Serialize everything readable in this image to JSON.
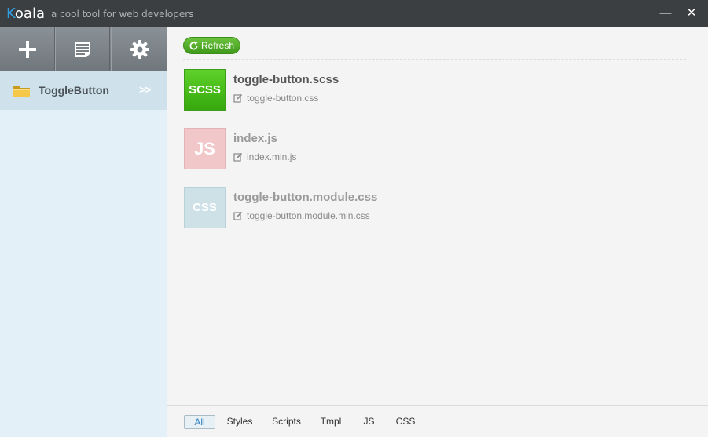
{
  "window": {
    "app_name_first": "K",
    "app_name_rest": "oala",
    "tagline": "a cool tool for web developers",
    "minimize_glyph": "—",
    "close_glyph": "✕"
  },
  "sidebar": {
    "toolbar": [
      {
        "icon": "plus-icon"
      },
      {
        "icon": "document-icon"
      },
      {
        "icon": "gear-icon"
      }
    ],
    "project": {
      "icon": "folder-icon",
      "name": "ToggleButton",
      "arrow": ">>"
    }
  },
  "main": {
    "refresh_label": "Refresh",
    "files": [
      {
        "badge": "SCSS",
        "name": "toggle-button.scss",
        "output": "toggle-button.css",
        "active": true
      },
      {
        "badge": "JS",
        "name": "index.js",
        "output": "index.min.js",
        "active": false
      },
      {
        "badge": "CSS",
        "name": "toggle-button.module.css",
        "output": "toggle-button.module.min.css",
        "active": false
      }
    ]
  },
  "filters": {
    "items": [
      "All",
      "Styles",
      "Scripts",
      "Tmpl",
      "JS",
      "CSS"
    ],
    "selected": "All"
  },
  "colors": {
    "accent": "#2f9fe6",
    "refresh_green": "#4fae26",
    "scss_green": "#4bbf1f",
    "js_pink": "#f1c7c9",
    "css_blue": "#cde1e6"
  }
}
